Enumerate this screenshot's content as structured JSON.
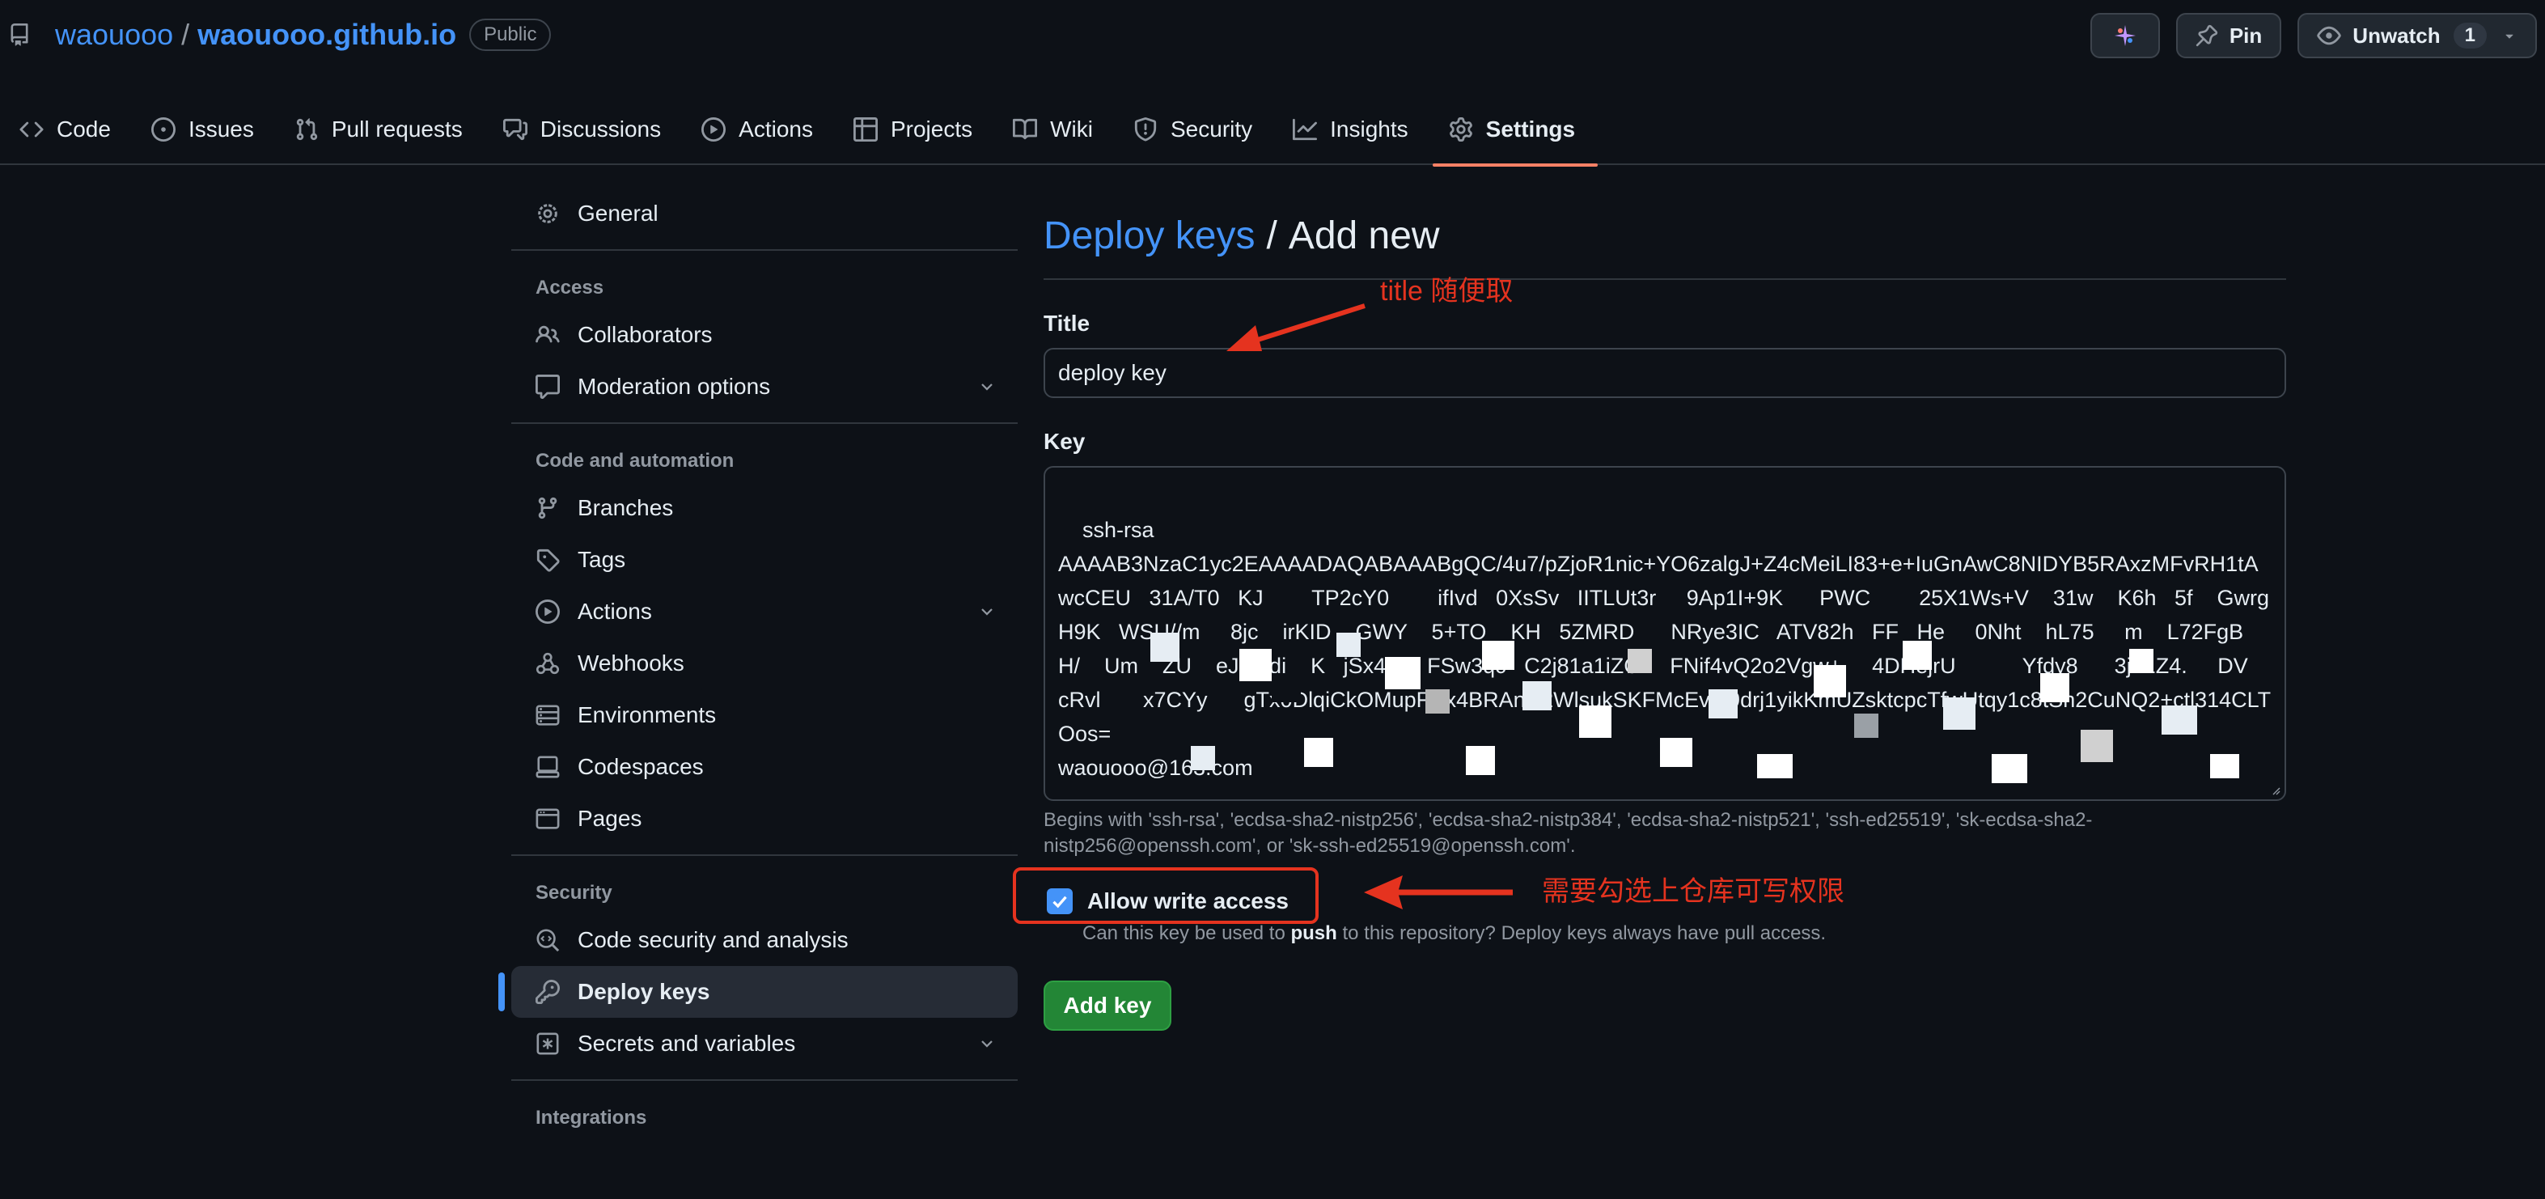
{
  "repo": {
    "owner": "waouooo",
    "separator": "/",
    "name": "waouooo.github.io",
    "visibility": "Public"
  },
  "header_buttons": {
    "pin": "Pin",
    "unwatch": "Unwatch",
    "watch_count": "1"
  },
  "tabs": [
    {
      "label": "Code",
      "icon": "code-icon"
    },
    {
      "label": "Issues",
      "icon": "issue-icon"
    },
    {
      "label": "Pull requests",
      "icon": "pull-request-icon"
    },
    {
      "label": "Discussions",
      "icon": "discussion-icon"
    },
    {
      "label": "Actions",
      "icon": "play-icon"
    },
    {
      "label": "Projects",
      "icon": "table-icon"
    },
    {
      "label": "Wiki",
      "icon": "book-icon"
    },
    {
      "label": "Security",
      "icon": "shield-icon"
    },
    {
      "label": "Insights",
      "icon": "graph-icon"
    },
    {
      "label": "Settings",
      "icon": "gear-icon",
      "active": true
    }
  ],
  "sidebar": {
    "general": "General",
    "access_heading": "Access",
    "collaborators": "Collaborators",
    "moderation": "Moderation options",
    "code_heading": "Code and automation",
    "branches": "Branches",
    "tags": "Tags",
    "actions": "Actions",
    "webhooks": "Webhooks",
    "environments": "Environments",
    "codespaces": "Codespaces",
    "pages": "Pages",
    "security_heading": "Security",
    "code_security": "Code security and analysis",
    "deploy_keys": "Deploy keys",
    "secrets": "Secrets and variables",
    "integrations_heading": "Integrations"
  },
  "main": {
    "breadcrumb": "Deploy keys",
    "separator": "/",
    "title": "Add new",
    "title_label": "Title",
    "title_value": "deploy key",
    "key_label": "Key",
    "key_value": "ssh-rsa\nAAAAB3NzaC1yc2EAAAADAQABAAABgQC/4u7/pZjoR1nic+YO6zalgJ+Z4cMeiLI83+e+IuGnAwC8NIDYB5RAxzMFvRH1tA   wcCEU   31A/T0   KJ        TP2cY0        ifIvd   0XsSv   IITLUt3r     9Ap1I+9K      PWC        25X1Ws+V    31w    K6h   5f    Gwrg   H9K   WSU//m     8jc    irKID    GWY    5+TO    KH   5ZMRD      NRye3IC   ATV82h   FF   He     0Nht    hL75     m    L72FgB    H/    Um    ZU    eJeetdi    K   jSx4Q    FSw3qc   C2j81a1iZC.    FNif4vQ2o2Vgw+     4DHejrU           Yfdy8      3j21Z4.     DV     cRvl       x7CYy      gTx0DlqiCkOMupFNx4BRAnw2WlsukSKFMcEvm9drj1yikKmUZsktcpcTfwUtqy1c8tSn2CuNQ2+ctl314CLTOos=\nwaouooo@163.com",
    "key_help": "Begins with 'ssh-rsa', 'ecdsa-sha2-nistp256', 'ecdsa-sha2-nistp384', 'ecdsa-sha2-nistp521', 'ssh-ed25519', 'sk-ecdsa-sha2-nistp256@openssh.com', or 'sk-ssh-ed25519@openssh.com'.",
    "allow_write_label": "Allow write access",
    "allow_write_checked": true,
    "allow_write_desc_pre": "Can this key be used to ",
    "allow_write_desc_bold": "push",
    "allow_write_desc_post": " to this repository? Deploy keys always have pull access.",
    "add_button": "Add key"
  },
  "annotations": {
    "title_note": "title 随便取",
    "write_note": "需要勾选上仓库可写权限",
    "color": "#e5331f"
  }
}
